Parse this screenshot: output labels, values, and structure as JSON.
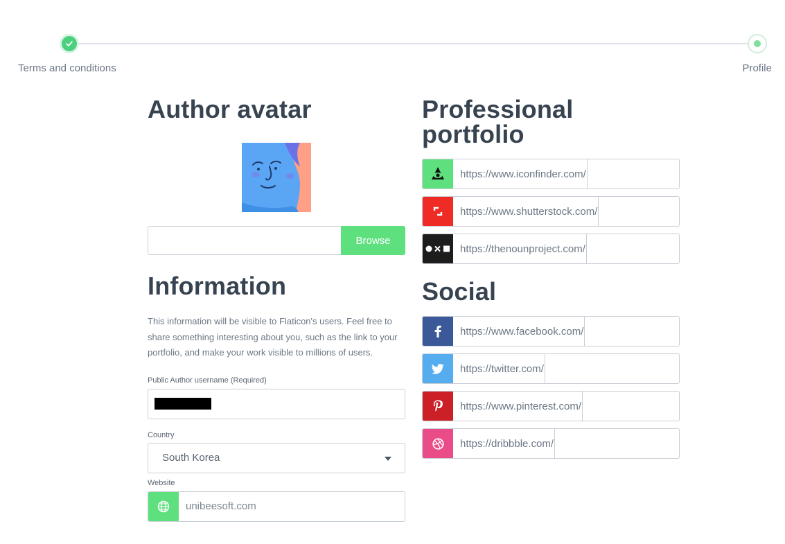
{
  "stepper": {
    "steps": [
      {
        "label": "Terms and conditions",
        "state": "done"
      },
      {
        "label": "Profile",
        "state": "current"
      }
    ]
  },
  "avatar_section": {
    "title": "Author avatar",
    "browse_label": "Browse",
    "file_value": ""
  },
  "information": {
    "title": "Information",
    "description": "This information will be visible to Flaticon's users. Feel free to share something interesting about you, such as the link to your portfolio, and make your work visible to millions of users.",
    "username_label": "Public Author username (Required)",
    "country_label": "Country",
    "country_value": "South Korea",
    "website_label": "Website",
    "website_value": "unibeesoft.com"
  },
  "portfolio": {
    "title": "Professional portfolio",
    "items": [
      {
        "prefix": "https://www.iconfinder.com/",
        "icon": "iconfinder-icon",
        "color": "#5fe07f"
      },
      {
        "prefix": "https://www.shutterstock.com/",
        "icon": "shutterstock-icon",
        "color": "#ee2b24"
      },
      {
        "prefix": "https://thenounproject.com/",
        "icon": "nounproject-icon",
        "color": "#1d1d1d"
      }
    ]
  },
  "social": {
    "title": "Social",
    "items": [
      {
        "prefix": "https://www.facebook.com/",
        "icon": "facebook-icon",
        "color": "#3b5998"
      },
      {
        "prefix": "https://twitter.com/",
        "icon": "twitter-icon",
        "color": "#55acee"
      },
      {
        "prefix": "https://www.pinterest.com/",
        "icon": "pinterest-icon",
        "color": "#cb2027"
      },
      {
        "prefix": "https://dribbble.com/",
        "icon": "dribbble-icon",
        "color": "#ea4c89"
      }
    ]
  },
  "colors": {
    "accent": "#5fe07f",
    "step_done": "#4cd07d",
    "heading": "#374350"
  }
}
